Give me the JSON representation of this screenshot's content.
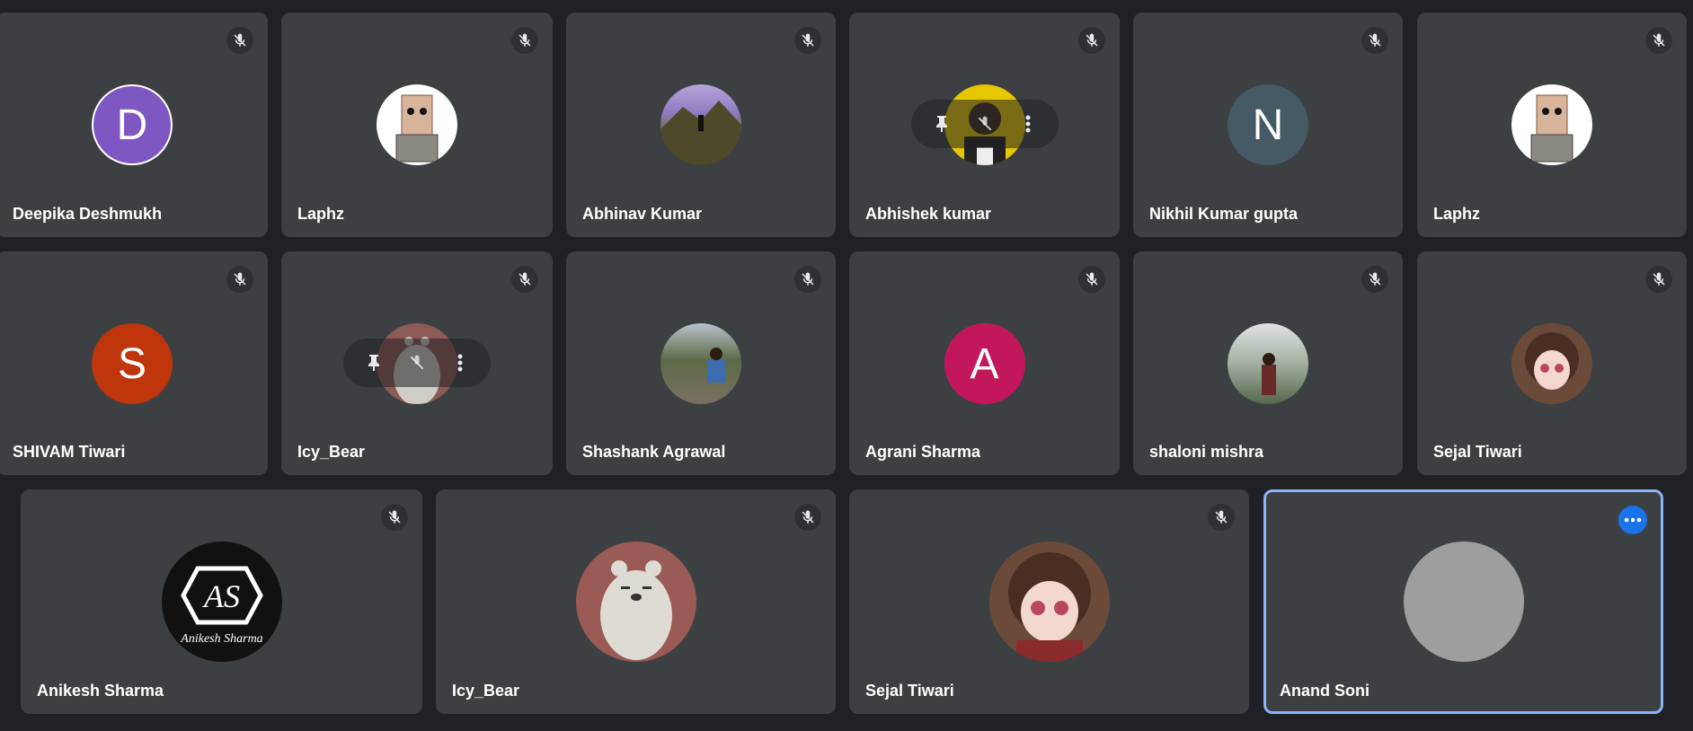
{
  "meeting": {
    "participants": [
      {
        "name": "Deepika Deshmukh",
        "avatar_type": "initial",
        "initial": "D",
        "avatar_color": "#7e57c2",
        "muted": true
      },
      {
        "name": "Laphz",
        "avatar_type": "image",
        "avatar_desc": "paper-bag-character",
        "muted": true
      },
      {
        "name": "Abhinav Kumar",
        "avatar_type": "image",
        "avatar_desc": "mountain-hiker-photo",
        "muted": true
      },
      {
        "name": "Abhishek kumar",
        "avatar_type": "image",
        "avatar_desc": "person-yellow-background",
        "muted": true,
        "hover_controls": true
      },
      {
        "name": "Nikhil Kumar gupta",
        "avatar_type": "initial",
        "initial": "N",
        "avatar_color": "#455a64",
        "muted": true
      },
      {
        "name": "Laphz",
        "avatar_type": "image",
        "avatar_desc": "paper-bag-character",
        "muted": true
      },
      {
        "name": "SHIVAM Tiwari",
        "avatar_type": "initial",
        "initial": "S",
        "avatar_color": "#bf360c",
        "muted": true
      },
      {
        "name": "Icy_Bear",
        "avatar_type": "image",
        "avatar_desc": "polar-bear-cartoon",
        "muted": true,
        "hover_controls": true
      },
      {
        "name": "Shashank Agrawal",
        "avatar_type": "image",
        "avatar_desc": "person-sitting-outdoors-photo",
        "muted": true
      },
      {
        "name": "Agrani Sharma",
        "avatar_type": "initial",
        "initial": "A",
        "avatar_color": "#c2185b",
        "muted": true
      },
      {
        "name": "shaloni mishra",
        "avatar_type": "image",
        "avatar_desc": "woman-landscape-photo",
        "muted": true
      },
      {
        "name": "Sejal Tiwari",
        "avatar_type": "image",
        "avatar_desc": "anime-girl",
        "muted": true
      },
      {
        "name": "Anikesh Sharma",
        "avatar_type": "image",
        "avatar_desc": "logo-monogram",
        "logo_text": "AS",
        "logo_signature": "Anikesh Sharma",
        "muted": true
      },
      {
        "name": "Icy_Bear",
        "avatar_type": "image",
        "avatar_desc": "polar-bear-cartoon",
        "muted": true
      },
      {
        "name": "Sejal Tiwari",
        "avatar_type": "image",
        "avatar_desc": "anime-girl",
        "muted": true
      },
      {
        "name": "Anand Soni",
        "avatar_type": "placeholder",
        "muted": false,
        "active": true,
        "more_options": true
      }
    ]
  },
  "icons": {
    "mic_off": "mic-off-icon",
    "pin": "pin-icon",
    "more_vert": "more-vert-icon",
    "more_horiz": "more-horiz-icon"
  },
  "colors": {
    "background": "#202124",
    "tile": "#3c4043",
    "active_border": "#8ab4f8",
    "accent": "#1a73e8"
  }
}
